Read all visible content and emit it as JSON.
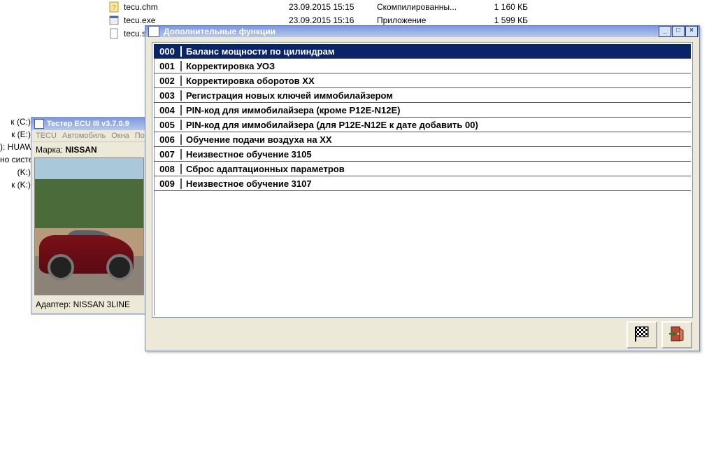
{
  "bg_files": [
    {
      "icon": "help-file-icon",
      "name": "tecu.chm",
      "date": "23.09.2015 15:15",
      "type": "Скомпилированны...",
      "size": "1 160 КБ"
    },
    {
      "icon": "app-file-icon",
      "name": "tecu.exe",
      "date": "23.09.2015 15:16",
      "type": "Приложение",
      "size": "1 599 КБ"
    },
    {
      "icon": "generic-file-icon",
      "name": "tecu.se",
      "date": "",
      "type": "",
      "size": ""
    }
  ],
  "left_tree": [
    "к (C:)",
    "к (E:)",
    "): HUAW",
    "но систе",
    "(K:)",
    "к (K:)"
  ],
  "tester": {
    "title": "Тестер ECU III v3.7.0.9",
    "menu": [
      "TECU",
      "Автомобиль",
      "Окна",
      "По"
    ],
    "marka_label": "Марка:",
    "marka_value": "NISSAN",
    "adapter_label": "Адаптер:",
    "adapter_value": "NISSAN 3LINE"
  },
  "dialog": {
    "title": "Дополнительные функции",
    "win_buttons": {
      "min": "_",
      "max": "□",
      "close": "×"
    },
    "rows": [
      {
        "num": "000",
        "label": "Баланс мощности по цилиндрам",
        "selected": true
      },
      {
        "num": "001",
        "label": "Корректировка УОЗ",
        "selected": false
      },
      {
        "num": "002",
        "label": "Корректировка оборотов XX",
        "selected": false
      },
      {
        "num": "003",
        "label": "Регистрация новых ключей иммобилайзером",
        "selected": false
      },
      {
        "num": "004",
        "label": "PIN-код для иммобилайзера (кроме P12E-N12E)",
        "selected": false
      },
      {
        "num": "005",
        "label": "PIN-код для иммобилайзера (для P12E-N12E к дате добавить 00)",
        "selected": false
      },
      {
        "num": "006",
        "label": "Обучение подачи воздуха на XX",
        "selected": false
      },
      {
        "num": "007",
        "label": "Неизвестное обучение 3105",
        "selected": false
      },
      {
        "num": "008",
        "label": "Сброс адаптационных параметров",
        "selected": false
      },
      {
        "num": "009",
        "label": "Неизвестное обучение 3107",
        "selected": false
      }
    ],
    "buttons": [
      {
        "name": "run-button",
        "icon": "flag-icon"
      },
      {
        "name": "exit-button",
        "icon": "door-exit-icon"
      }
    ]
  }
}
